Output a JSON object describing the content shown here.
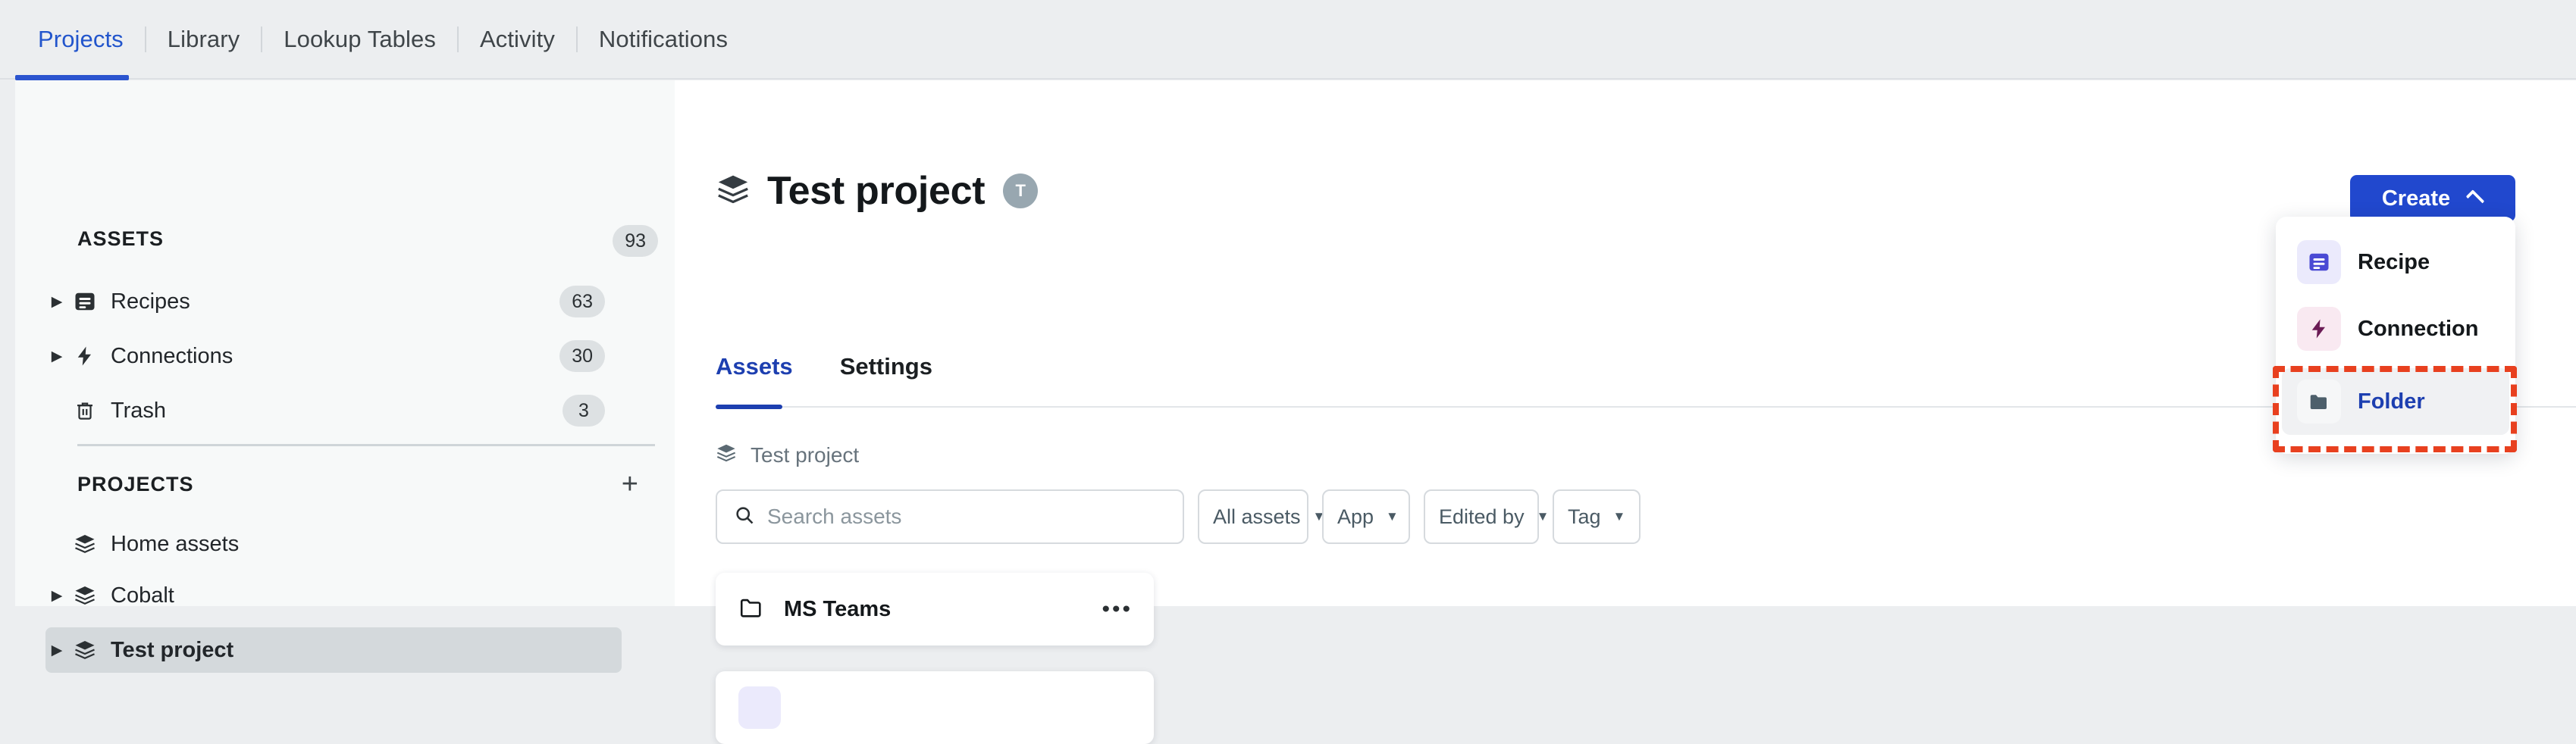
{
  "top_nav": {
    "tabs": [
      {
        "label": "Projects",
        "active": true
      },
      {
        "label": "Library",
        "active": false
      },
      {
        "label": "Lookup Tables",
        "active": false
      },
      {
        "label": "Activity",
        "active": false
      },
      {
        "label": "Notifications",
        "active": false
      }
    ]
  },
  "sidebar": {
    "assets_section": {
      "title": "ASSETS",
      "count": "93",
      "items": [
        {
          "label": "Recipes",
          "count": "63",
          "icon": "recipe-icon",
          "expandable": true
        },
        {
          "label": "Connections",
          "count": "30",
          "icon": "connection-icon",
          "expandable": true
        },
        {
          "label": "Trash",
          "count": "3",
          "icon": "trash-icon",
          "expandable": false
        }
      ]
    },
    "projects_section": {
      "title": "PROJECTS",
      "add_label": "+",
      "items": [
        {
          "label": "Home assets",
          "icon": "project-stack-icon",
          "expandable": false,
          "selected": false
        },
        {
          "label": "Cobalt",
          "icon": "project-stack-icon",
          "expandable": true,
          "selected": false
        },
        {
          "label": "Test project",
          "icon": "project-stack-icon",
          "expandable": true,
          "selected": true
        }
      ]
    }
  },
  "main": {
    "page_title": "Test project",
    "avatar_initial": "T",
    "tabs": [
      {
        "label": "Assets",
        "active": true
      },
      {
        "label": "Settings",
        "active": false
      }
    ],
    "breadcrumb": "Test project",
    "search": {
      "placeholder": "Search assets",
      "value": ""
    },
    "filters": [
      {
        "label": "All assets",
        "width": 146
      },
      {
        "label": "App",
        "width": 116
      },
      {
        "label": "Edited by",
        "width": 152
      },
      {
        "label": "Tag",
        "width": 116
      }
    ],
    "assets": [
      {
        "label": "MS Teams",
        "icon": "folder-outline-icon",
        "menu": "•••"
      }
    ]
  },
  "create": {
    "button_label": "Create",
    "menu_items": [
      {
        "label": "Recipe",
        "icon": "recipe-icon",
        "icon_bg": "#ebeafc",
        "icon_color": "#4a4ad4",
        "active": false
      },
      {
        "label": "Connection",
        "icon": "connection-icon",
        "icon_bg": "#f9e9f1",
        "icon_color": "#6b1b55",
        "active": false
      },
      {
        "label": "Folder",
        "icon": "folder-solid-icon",
        "icon_bg": "#f6f7f8",
        "icon_color": "#4d5f6b",
        "active": true
      }
    ]
  },
  "colors": {
    "accent_blue": "#2148ce",
    "link_blue": "#2255cc",
    "annotation_red": "#e8401f",
    "sidebar_bg": "#f7f9f9",
    "page_bg": "#eceef0"
  }
}
